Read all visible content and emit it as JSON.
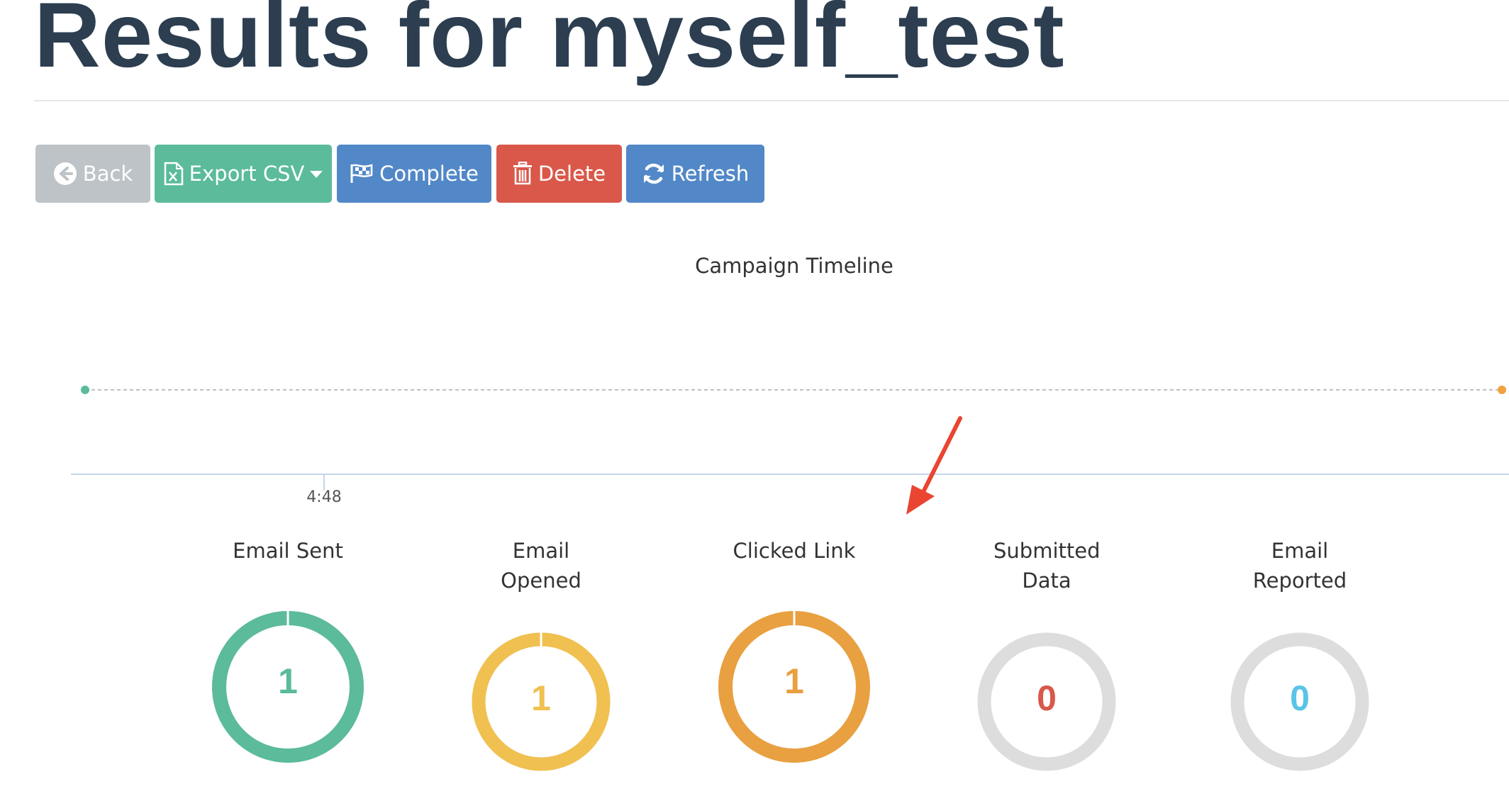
{
  "page": {
    "title": "Results for myself_test"
  },
  "toolbar": {
    "back_label": "Back",
    "export_label": "Export CSV",
    "complete_label": "Complete",
    "delete_label": "Delete",
    "refresh_label": "Refresh"
  },
  "timeline": {
    "title": "Campaign Timeline",
    "tick_label": "4:48",
    "start_point_color": "#5bbb9b",
    "end_point_color": "#f0a140"
  },
  "stats": [
    {
      "label": "Email Sent",
      "value": "1",
      "color": "#5bbb9b",
      "fraction": 1.0
    },
    {
      "label": "Email Opened",
      "value": "1",
      "color": "#f0c050",
      "fraction": 1.0
    },
    {
      "label": "Clicked Link",
      "value": "1",
      "color": "#e8a040",
      "fraction": 1.0
    },
    {
      "label": "Submitted Data",
      "value": "0",
      "color": "#d9584a",
      "fraction": 0.0
    },
    {
      "label": "Email Reported",
      "value": "0",
      "color": "#59c4e6",
      "fraction": 0.0
    }
  ],
  "colors": {
    "title": "#2c3e50",
    "ring_empty": "#dddddd",
    "annotation_arrow": "#e94530"
  }
}
